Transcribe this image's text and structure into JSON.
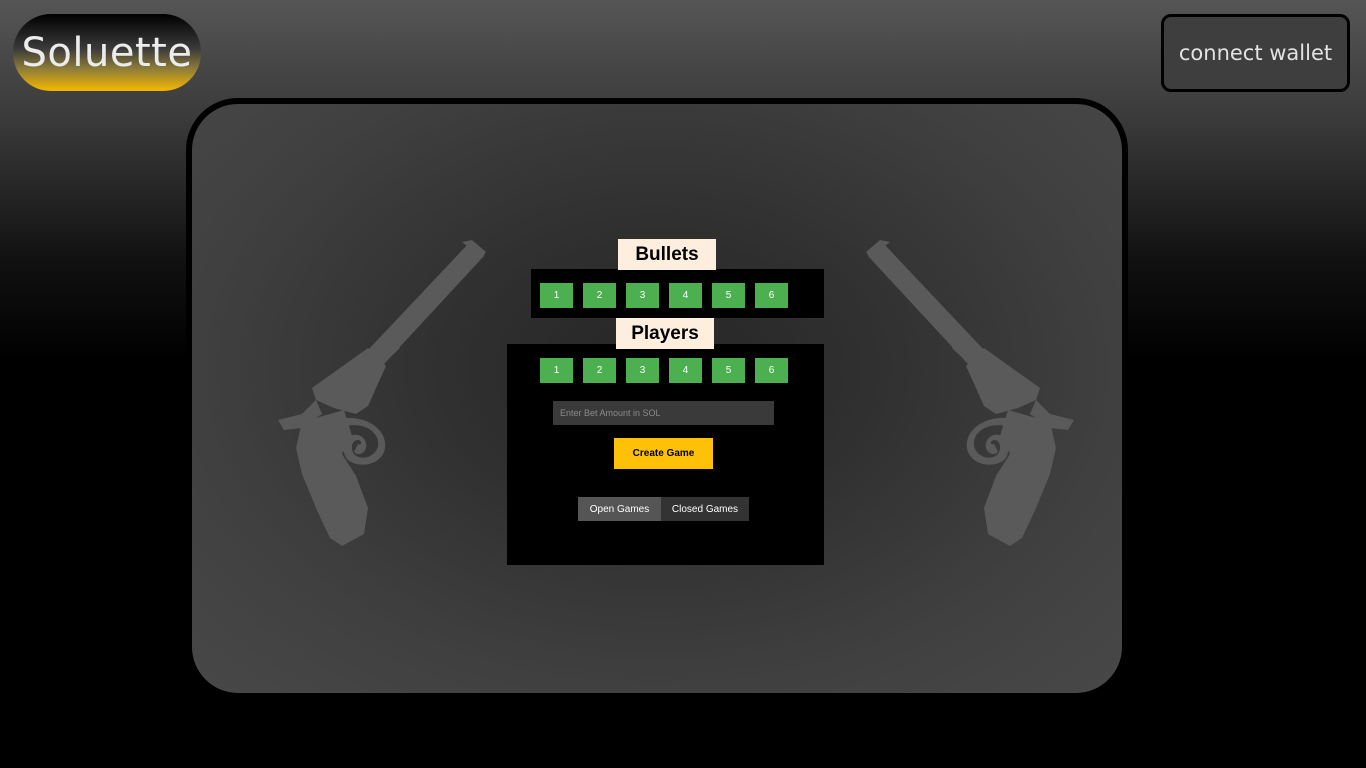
{
  "header": {
    "logo_text": "Soluette",
    "wallet_button_label": "connect wallet"
  },
  "game_panel": {
    "bullets": {
      "title": "Bullets",
      "options": [
        "1",
        "2",
        "3",
        "4",
        "5",
        "6"
      ]
    },
    "players": {
      "title": "Players",
      "options": [
        "1",
        "2",
        "3",
        "4",
        "5",
        "6"
      ]
    },
    "bet_input": {
      "placeholder": "Enter Bet Amount in SOL",
      "value": ""
    },
    "create_button_label": "Create Game",
    "tabs": [
      {
        "label": "Open Games",
        "active": true
      },
      {
        "label": "Closed Games",
        "active": false
      }
    ]
  },
  "colors": {
    "accent_yellow": "#ffc107",
    "option_green": "#4caf50",
    "tag_background": "#fdeedd"
  },
  "icons": [
    "revolver-icon-left",
    "revolver-icon-right"
  ]
}
